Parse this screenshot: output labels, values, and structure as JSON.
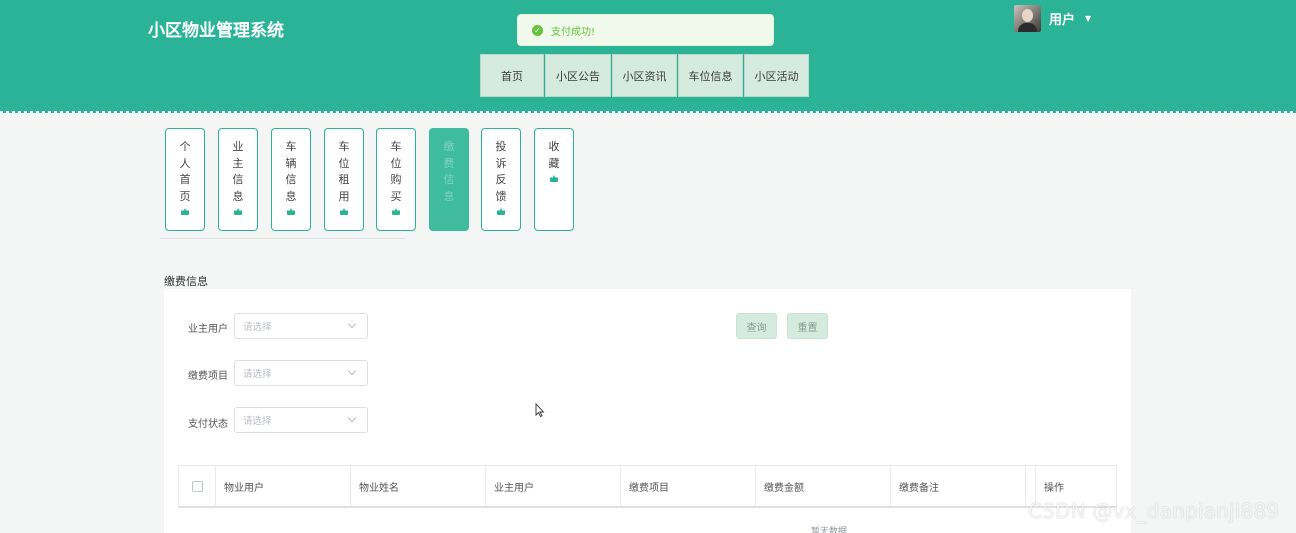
{
  "header": {
    "site_title": "小区物业管理系统",
    "user_name": "用户",
    "toast": "支付成功!"
  },
  "nav": {
    "items": [
      "首页",
      "小区公告",
      "小区资讯",
      "车位信息",
      "小区活动"
    ]
  },
  "side_menu": {
    "items": [
      {
        "label": "个人首页",
        "chars": [
          "个",
          "人",
          "首",
          "页"
        ]
      },
      {
        "label": "业主信息",
        "chars": [
          "业",
          "主",
          "信",
          "息"
        ]
      },
      {
        "label": "车辆信息",
        "chars": [
          "车",
          "辆",
          "信",
          "息"
        ]
      },
      {
        "label": "车位租用",
        "chars": [
          "车",
          "位",
          "租",
          "用"
        ]
      },
      {
        "label": "车位购买",
        "chars": [
          "车",
          "位",
          "购",
          "买"
        ]
      },
      {
        "label": "缴费信息",
        "chars": [
          "缴",
          "费",
          "信",
          "息"
        ],
        "active": true
      },
      {
        "label": "投诉反馈",
        "chars": [
          "投",
          "诉",
          "反",
          "馈"
        ]
      },
      {
        "label": "收藏",
        "chars": [
          "收",
          "藏"
        ]
      }
    ],
    "active_index": 5
  },
  "section_title": "缴费信息",
  "filters": {
    "owner_user": {
      "label": "业主用户",
      "placeholder": "请选择"
    },
    "fee_item": {
      "label": "缴费项目",
      "placeholder": "请选择"
    },
    "pay_status": {
      "label": "支付状态",
      "placeholder": "请选择"
    }
  },
  "buttons": {
    "query": "查询",
    "reset": "重置"
  },
  "table": {
    "columns": [
      "物业用户",
      "物业姓名",
      "业主用户",
      "缴费项目",
      "缴费金额",
      "缴费备注",
      "操作"
    ],
    "empty_text": "暂无数据"
  },
  "watermark": "CSDN @vx_danpianji889",
  "colors": {
    "brand": "#2bb398",
    "nav_bg": "#d6ebe0",
    "toast_bg": "#f0f9eb",
    "toast_text": "#67c23a"
  }
}
